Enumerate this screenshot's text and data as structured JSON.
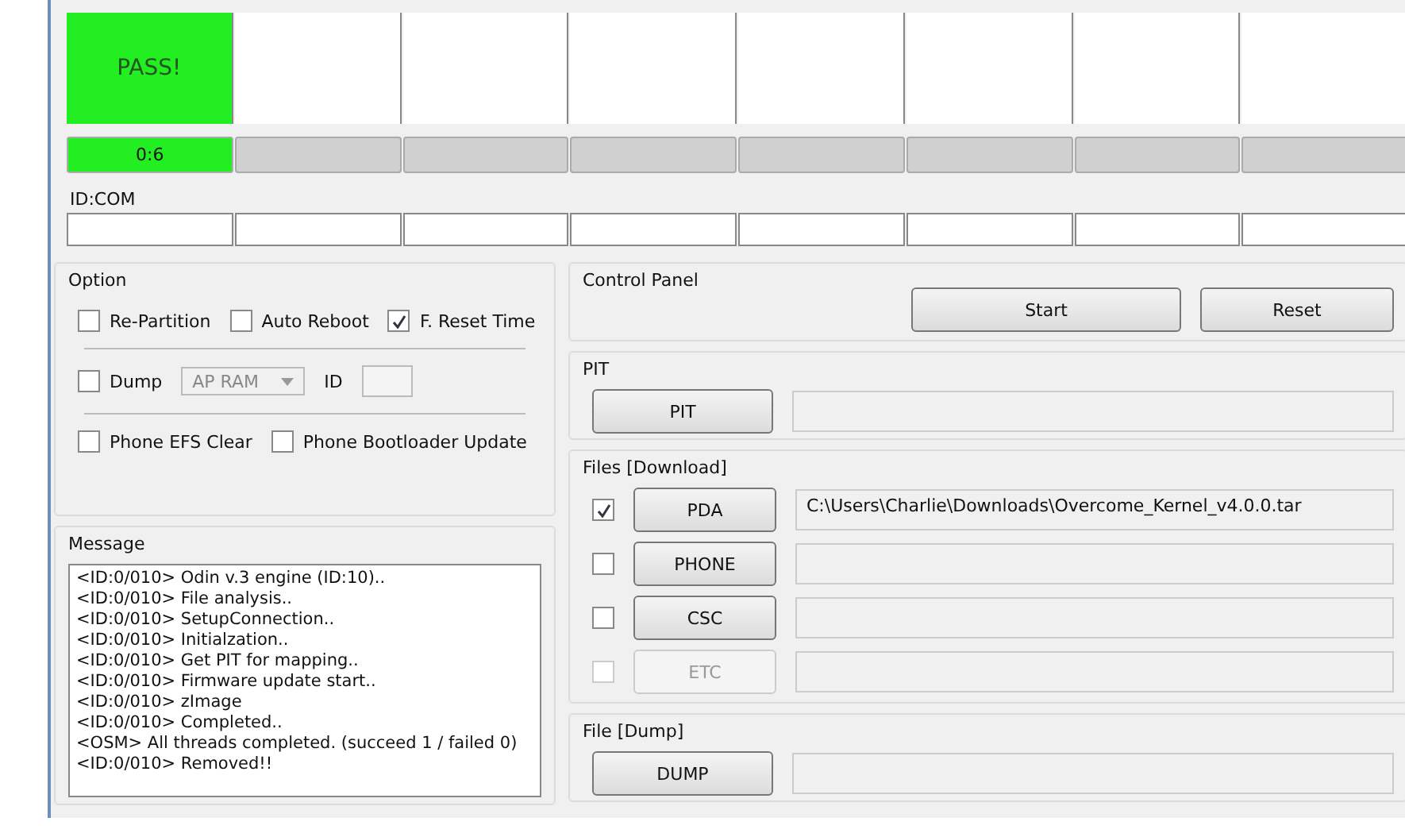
{
  "slots": [
    {
      "passed": true,
      "status": "PASS!",
      "progress": "0:6",
      "level": 1
    },
    {
      "passed": false,
      "level": 0
    },
    {
      "passed": false,
      "level": 0
    },
    {
      "passed": false,
      "level": 0
    },
    {
      "passed": false,
      "level": 0
    },
    {
      "passed": false,
      "level": 0
    },
    {
      "passed": false,
      "level": 0
    },
    {
      "passed": false,
      "level": 0
    }
  ],
  "id_com_label": "ID:COM",
  "option": {
    "title": "Option",
    "row1": [
      {
        "label": "Re-Partition",
        "checked": false
      },
      {
        "label": "Auto Reboot",
        "checked": false
      },
      {
        "label": "F. Reset Time",
        "checked": true
      }
    ],
    "dump": {
      "label": "Dump",
      "checked": false,
      "select": "AP RAM",
      "select_disabled": true,
      "id_label": "ID"
    },
    "row3": [
      {
        "label": "Phone EFS Clear",
        "checked": false
      },
      {
        "label": "Phone Bootloader Update",
        "checked": false
      }
    ]
  },
  "message": {
    "title": "Message",
    "lines": [
      "<ID:0/010> Odin v.3 engine (ID:10)..",
      "<ID:0/010> File analysis..",
      "<ID:0/010> SetupConnection..",
      "<ID:0/010> Initialzation..",
      "<ID:0/010> Get PIT for mapping..",
      "<ID:0/010> Firmware update start..",
      "<ID:0/010> zImage",
      "<ID:0/010> Completed..",
      "<OSM> All threads completed. (succeed 1 / failed 0)",
      "<ID:0/010> Removed!!"
    ]
  },
  "control_panel": {
    "title": "Control Panel",
    "buttons": [
      "Start",
      "Reset"
    ]
  },
  "pit": {
    "title": "PIT",
    "button": "PIT"
  },
  "files": {
    "title": "Files [Download]",
    "items": [
      {
        "label": "PDA",
        "checked": true,
        "disabled": false,
        "path": "C:\\Users\\Charlie\\Downloads\\Overcome_Kernel_v4.0.0.tar"
      },
      {
        "label": "PHONE",
        "checked": false,
        "disabled": false
      },
      {
        "label": "CSC",
        "checked": false,
        "disabled": false
      },
      {
        "label": "ETC",
        "checked": false,
        "disabled": true
      }
    ]
  },
  "file_dump": {
    "title": "File [Dump]",
    "button": "DUMP"
  }
}
